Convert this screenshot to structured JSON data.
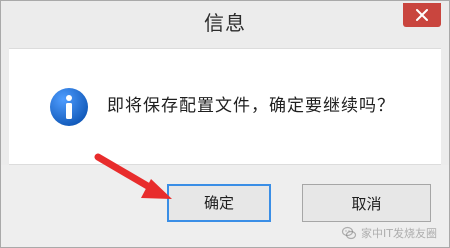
{
  "window": {
    "title": "信息",
    "close_icon": "close-icon"
  },
  "content": {
    "icon": "info-icon",
    "message": "即将保存配置文件，确定要继续吗？"
  },
  "buttons": {
    "ok_label": "确定",
    "cancel_label": "取消"
  },
  "watermark": {
    "text": "家中IT发烧友圈",
    "icon": "wechat-icon"
  },
  "colors": {
    "close_button": "#c9453e",
    "info_icon": "#1f6fd6",
    "arrow": "#e82c2c",
    "focus_border": "#3a8ee6"
  }
}
